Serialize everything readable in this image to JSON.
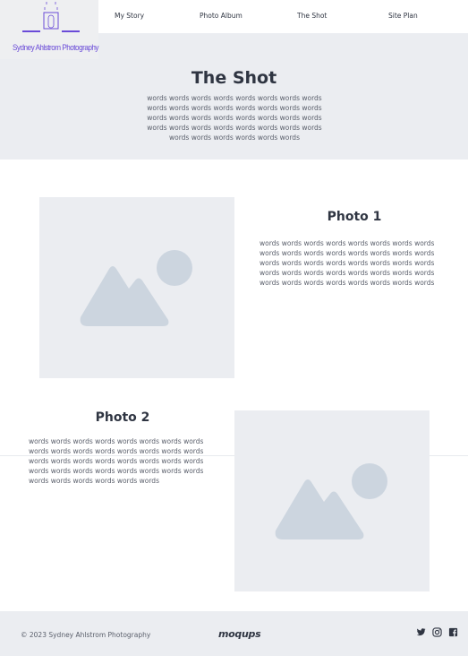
{
  "logo": {
    "text": "Sydney Ahlstrom Photography",
    "accent": "#6a4bd8"
  },
  "nav": {
    "items": [
      {
        "label": "My Story"
      },
      {
        "label": "Photo Album"
      },
      {
        "label": "The Shot"
      },
      {
        "label": "Site Plan"
      }
    ]
  },
  "hero": {
    "title": "The Shot",
    "text": "words words words words words words words words words words words words words words words words words words words words words words words words words words words words words words words words words words words words words words"
  },
  "sections": [
    {
      "title": "Photo 1",
      "text": "words words words words words words words words words words words words words words words words words words words words words words words words words words words words words words words words words words words words words words words words",
      "image_icon": "image-placeholder-icon"
    },
    {
      "title": "Photo 2",
      "text": "words words words words words words words words words words words words words words words words words words words words words words words words words words words words words words words words words words words words words words",
      "image_icon": "image-placeholder-icon"
    }
  ],
  "footer": {
    "copyright": "© 2023 Sydney Ahlstrom Photography",
    "brand": "moqups",
    "social": [
      "twitter-icon",
      "instagram-icon",
      "facebook-icon"
    ]
  },
  "colors": {
    "panel": "#ebedf1",
    "placeholder": "#ccd5df",
    "text": "#2f3542"
  }
}
